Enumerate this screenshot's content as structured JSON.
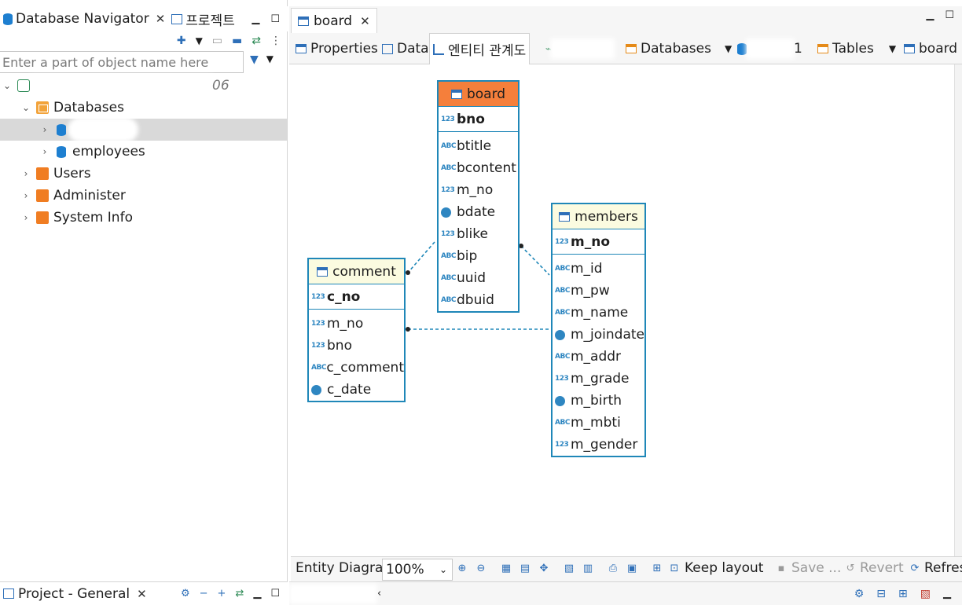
{
  "left_panel": {
    "tabs": [
      {
        "label": "Database Navigator",
        "icon": "database-navigator-icon"
      },
      {
        "label": "프로젝트",
        "icon": "project-icon"
      }
    ],
    "filter_placeholder": "Enter a part of object name here",
    "tree": {
      "connection_label": "06",
      "databases_label": "Databases",
      "db_employees": "employees",
      "users": "Users",
      "administer": "Administer",
      "system_info": "System Info"
    },
    "bottom_tab": "Project - General"
  },
  "editor": {
    "tab_label": "board",
    "subtabs": {
      "properties": "Properties",
      "data": "Data",
      "erd": "엔티티 관계도",
      "databases": "Databases",
      "db_suffix": "1",
      "tables": "Tables",
      "board": "board"
    }
  },
  "erd": {
    "entities": {
      "board": {
        "name": "board",
        "pk": "bno",
        "columns": [
          "btitle",
          "bcontent",
          "m_no",
          "bdate",
          "blike",
          "bip",
          "uuid",
          "dbuid"
        ]
      },
      "members": {
        "name": "members",
        "pk": "m_no",
        "columns": [
          "m_id",
          "m_pw",
          "m_name",
          "m_joindate",
          "m_addr",
          "m_grade",
          "m_birth",
          "m_mbti",
          "m_gender"
        ]
      },
      "comment": {
        "name": "comment",
        "pk": "c_no",
        "columns": [
          "m_no",
          "bno",
          "c_comment",
          "c_date"
        ]
      }
    },
    "type_labels": {
      "number": "123",
      "text": "ABC"
    }
  },
  "diagram_toolbar": {
    "mode_label": "Entity Diagra",
    "zoom": "100%",
    "keep_layout": "Keep layout",
    "save": "Save ...",
    "revert": "Revert",
    "refresh": "Refres"
  }
}
